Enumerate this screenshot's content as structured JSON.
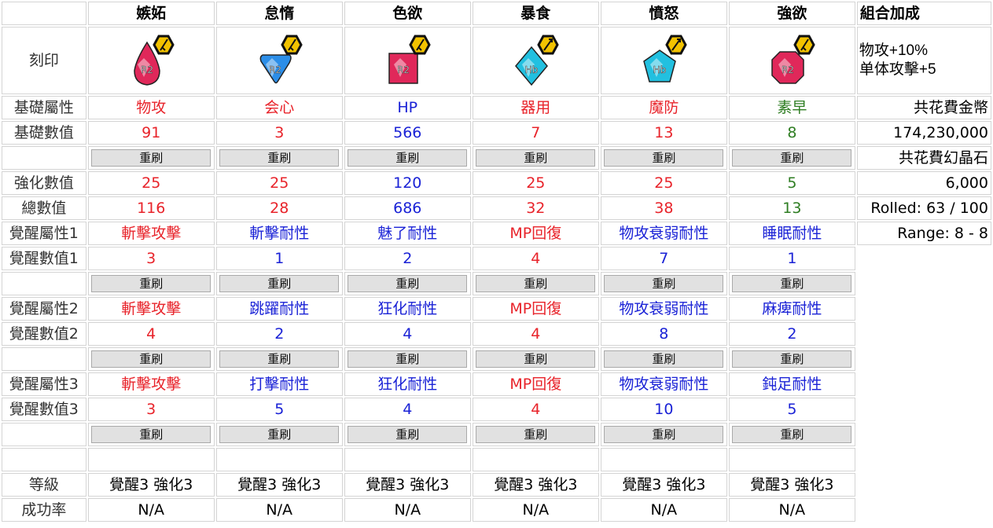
{
  "header": {
    "blank": "",
    "columns": [
      "嫉妬",
      "怠惰",
      "色欲",
      "暴食",
      "憤怒",
      "強欲"
    ],
    "combo_title": "組合加成"
  },
  "labels": {
    "engrave": "刻印",
    "base_attr": "基礎屬性",
    "base_value": "基礎數值",
    "enhance_value": "強化數值",
    "total_value": "總數值",
    "awaken_attr_1": "覺醒屬性1",
    "awaken_value_1": "覺醒數值1",
    "awaken_attr_2": "覺醒屬性2",
    "awaken_value_2": "覺醒數值2",
    "awaken_attr_3": "覺醒屬性3",
    "awaken_value_3": "覺醒數值3",
    "level": "等級",
    "success_rate": "成功率"
  },
  "reroll_label": "重刷",
  "gems": [
    {
      "icon": "red-teardrop-gem-icon",
      "color": "#e0285a",
      "shape": "drop",
      "badge": "sword"
    },
    {
      "icon": "blue-triangle-gem-icon",
      "color": "#2c8ee8",
      "shape": "tri",
      "badge": "sword"
    },
    {
      "icon": "red-square-gem-icon",
      "color": "#e0285a",
      "shape": "square",
      "badge": "sword"
    },
    {
      "icon": "cyan-diamond-gem-icon",
      "color": "#22c0e0",
      "shape": "diamond",
      "badge": "arrow"
    },
    {
      "icon": "cyan-pentagon-gem-icon",
      "color": "#22c0e0",
      "shape": "pent",
      "badge": "arrow"
    },
    {
      "icon": "red-octagon-gem-icon",
      "color": "#e0285a",
      "shape": "oct",
      "badge": "sword"
    }
  ],
  "base_attr": [
    {
      "text": "物攻",
      "color": "red"
    },
    {
      "text": "会心",
      "color": "red"
    },
    {
      "text": "HP",
      "color": "blue"
    },
    {
      "text": "器用",
      "color": "red"
    },
    {
      "text": "魔防",
      "color": "red"
    },
    {
      "text": "素早",
      "color": "green"
    }
  ],
  "base_value": [
    "91",
    "3",
    "566",
    "7",
    "13",
    "8"
  ],
  "enhance_value": [
    "25",
    "25",
    "120",
    "25",
    "25",
    "5"
  ],
  "total_value": [
    "116",
    "28",
    "686",
    "32",
    "38",
    "13"
  ],
  "awaken_1": {
    "attr": [
      {
        "text": "斬擊攻擊",
        "color": "red"
      },
      {
        "text": "斬擊耐性",
        "color": "blue"
      },
      {
        "text": "魅了耐性",
        "color": "blue"
      },
      {
        "text": "MP回復",
        "color": "red"
      },
      {
        "text": "物攻衰弱耐性",
        "color": "blue"
      },
      {
        "text": "睡眠耐性",
        "color": "blue"
      }
    ],
    "value": [
      {
        "text": "3",
        "color": "red"
      },
      {
        "text": "1",
        "color": "blue"
      },
      {
        "text": "2",
        "color": "blue"
      },
      {
        "text": "4",
        "color": "red"
      },
      {
        "text": "7",
        "color": "blue"
      },
      {
        "text": "1",
        "color": "blue"
      }
    ]
  },
  "awaken_2": {
    "attr": [
      {
        "text": "斬擊攻擊",
        "color": "red"
      },
      {
        "text": "跳躍耐性",
        "color": "blue"
      },
      {
        "text": "狂化耐性",
        "color": "blue"
      },
      {
        "text": "MP回復",
        "color": "red"
      },
      {
        "text": "物攻衰弱耐性",
        "color": "blue"
      },
      {
        "text": "麻痺耐性",
        "color": "blue"
      }
    ],
    "value": [
      {
        "text": "4",
        "color": "red"
      },
      {
        "text": "2",
        "color": "blue"
      },
      {
        "text": "4",
        "color": "blue"
      },
      {
        "text": "4",
        "color": "red"
      },
      {
        "text": "8",
        "color": "blue"
      },
      {
        "text": "2",
        "color": "blue"
      }
    ]
  },
  "awaken_3": {
    "attr": [
      {
        "text": "斬擊攻擊",
        "color": "red"
      },
      {
        "text": "打擊耐性",
        "color": "blue"
      },
      {
        "text": "狂化耐性",
        "color": "blue"
      },
      {
        "text": "MP回復",
        "color": "red"
      },
      {
        "text": "物攻衰弱耐性",
        "color": "blue"
      },
      {
        "text": "鈍足耐性",
        "color": "blue"
      }
    ],
    "value": [
      {
        "text": "3",
        "color": "red"
      },
      {
        "text": "5",
        "color": "blue"
      },
      {
        "text": "4",
        "color": "blue"
      },
      {
        "text": "4",
        "color": "red"
      },
      {
        "text": "10",
        "color": "blue"
      },
      {
        "text": "5",
        "color": "blue"
      }
    ]
  },
  "level": [
    "覺醒3 強化3",
    "覺醒3 強化3",
    "覺醒3 強化3",
    "覺醒3 強化3",
    "覺醒3 強化3",
    "覺醒3 強化3"
  ],
  "success_rate": [
    "N/A",
    "N/A",
    "N/A",
    "N/A",
    "N/A",
    "N/A"
  ],
  "side": {
    "bonus_line1": "物攻+10%",
    "bonus_line2": "单体攻擊+5",
    "gold_label": "共花費金幣",
    "gold_value": "174,230,000",
    "crystal_label": "共花費幻晶石",
    "crystal_value": "6,000",
    "rolled": "Rolled: 63 / 100",
    "range": "Range: 8 - 8"
  },
  "colors": {
    "red": "#e8232a",
    "blue": "#1a22d6",
    "green": "#2e7d22",
    "badge": "#f2c200",
    "badge_bg": "#111111"
  }
}
